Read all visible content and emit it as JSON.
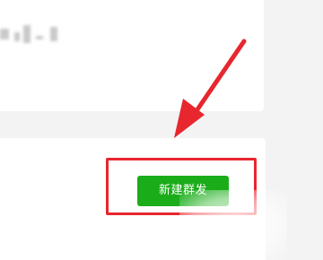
{
  "toolbar": {
    "new_group_label": "新建群发"
  },
  "colors": {
    "button_green": "#1aad19",
    "highlight_red": "#e8262e",
    "background": "#f3f3f3"
  },
  "annotations": {
    "arrow_icon": "red-arrow-icon",
    "highlight": "red-highlight-box"
  }
}
